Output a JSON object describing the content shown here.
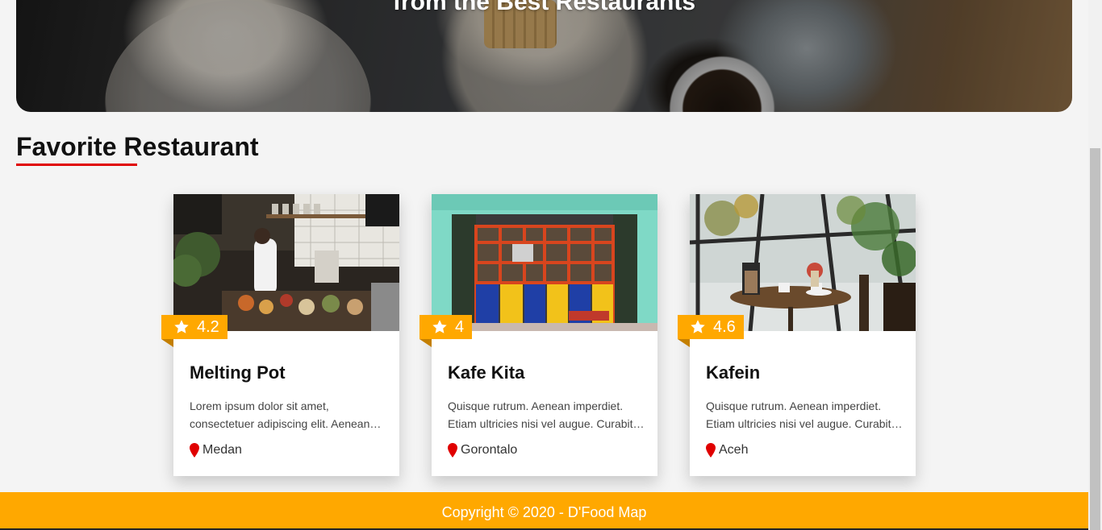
{
  "hero": {
    "title": "from the Best Restaurants"
  },
  "section": {
    "title": "Favorite Restaurant",
    "accent_color": "#e00000"
  },
  "restaurants": [
    {
      "name": "Melting Pot",
      "rating": "4.2",
      "description": "Lorem ipsum dolor sit amet, consectetuer adipiscing elit. Aenean…",
      "city": "Medan",
      "image": "kitchen-counter-chef-photo"
    },
    {
      "name": "Kafe Kita",
      "rating": "4",
      "description": "Quisque rutrum. Aenean imperdiet. Etiam ultricies nisi vel augue. Curabit…",
      "city": "Gorontalo",
      "image": "colorful-shopfront-photo"
    },
    {
      "name": "Kafein",
      "rating": "4.6",
      "description": "Quisque rutrum. Aenean imperdiet. Etiam ultricies nisi vel augue. Curabit…",
      "city": "Aceh",
      "image": "cafe-table-french-press-photo"
    }
  ],
  "icons": {
    "rating": "star-icon",
    "location": "map-pin-icon"
  },
  "colors": {
    "rating_badge": "#ffa800",
    "footer": "#ffa800",
    "pin": "#e00000"
  },
  "footer": {
    "text": "Copyright © 2020 - D'Food Map"
  }
}
